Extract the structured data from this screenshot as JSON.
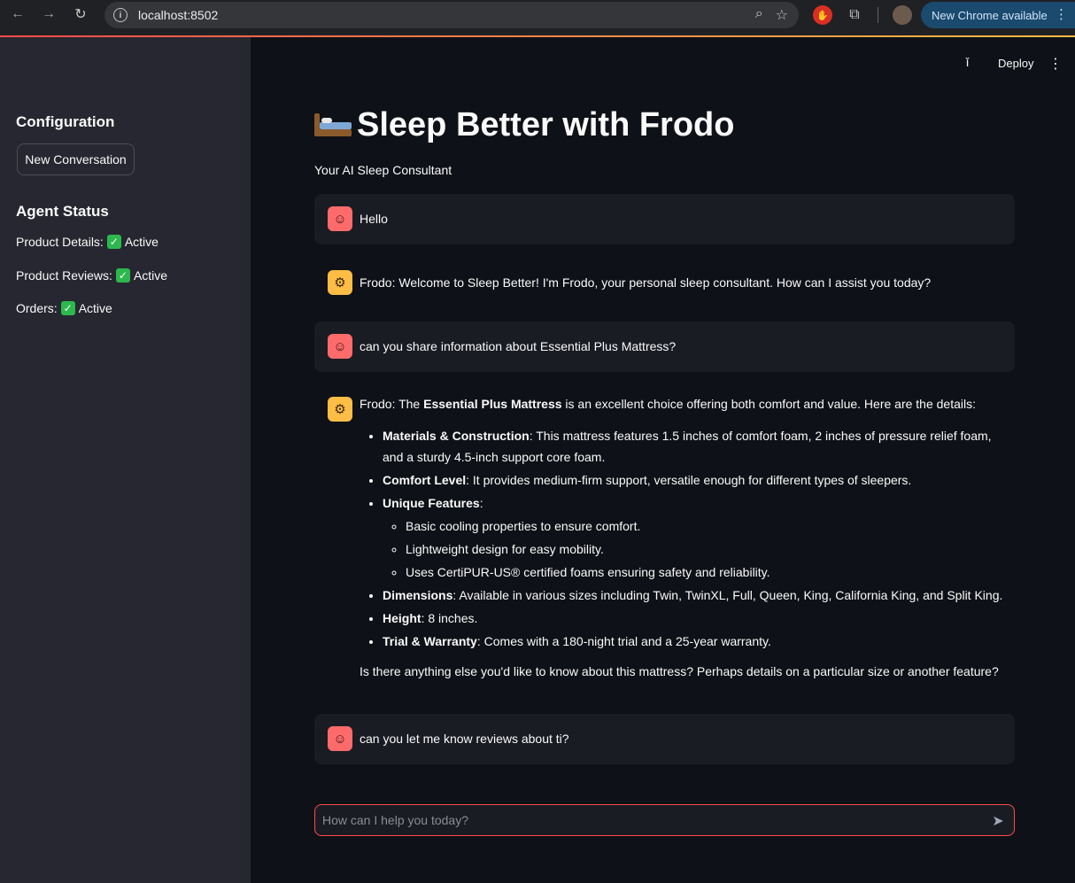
{
  "browser": {
    "url": "localhost:8502",
    "update_label": "New Chrome available"
  },
  "sidebar": {
    "config_heading": "Configuration",
    "new_conversation_label": "New Conversation",
    "status_heading": "Agent Status",
    "statuses": [
      {
        "label": "Product Details:",
        "value": "Active"
      },
      {
        "label": "Product Reviews:",
        "value": "Active"
      },
      {
        "label": "Orders:",
        "value": "Active"
      }
    ]
  },
  "header": {
    "deploy_label": "Deploy",
    "title": "Sleep Better with Frodo",
    "subtitle": "Your AI Sleep Consultant"
  },
  "messages": {
    "m1": "Hello",
    "m2": "Frodo: Welcome to Sleep Better! I'm Frodo, your personal sleep consultant. How can I assist you today?",
    "m3": "can you share information about Essential Plus Mattress?",
    "m4": {
      "intro_prefix": "Frodo: The ",
      "intro_bold": "Essential Plus Mattress",
      "intro_suffix": " is an excellent choice offering both comfort and value. Here are the details:",
      "items": [
        {
          "bold": "Materials & Construction",
          "text": ": This mattress features 1.5 inches of comfort foam, 2 inches of pressure relief foam, and a sturdy 4.5-inch support core foam."
        },
        {
          "bold": "Comfort Level",
          "text": ": It provides medium-firm support, versatile enough for different types of sleepers."
        },
        {
          "bold": "Unique Features",
          "text": ":"
        },
        {
          "bold": "Dimensions",
          "text": ": Available in various sizes including Twin, TwinXL, Full, Queen, King, California King, and Split King."
        },
        {
          "bold": "Height",
          "text": ": 8 inches."
        },
        {
          "bold": "Trial & Warranty",
          "text": ": Comes with a 180-night trial and a 25-year warranty."
        }
      ],
      "features": [
        "Basic cooling properties to ensure comfort.",
        "Lightweight design for easy mobility.",
        "Uses CertiPUR-US® certified foams ensuring safety and reliability."
      ],
      "outro": "Is there anything else you'd like to know about this mattress? Perhaps details on a particular size or another feature?"
    },
    "m5": "can you let me know reviews about ti?"
  },
  "chat_input": {
    "placeholder": "How can I help you today?"
  },
  "colors": {
    "accent": "#ff4b4b",
    "user_avatar": "#ff6b6b",
    "bot_avatar": "#ffbd45",
    "check": "#2db84d"
  }
}
